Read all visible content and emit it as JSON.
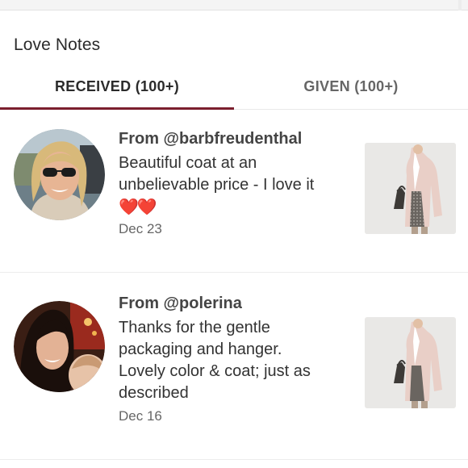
{
  "page": {
    "title": "Love Notes"
  },
  "tabs": [
    {
      "label": "RECEIVED (100+)",
      "active": true
    },
    {
      "label": "GIVEN (100+)",
      "active": false
    }
  ],
  "colors": {
    "accent": "#7b1f2e",
    "heart": "#e0202d"
  },
  "notes": [
    {
      "from": "From @barbfreudenthal",
      "message_lines": [
        "Beautiful coat at an",
        "unbelievable price - I love it"
      ],
      "emoji": "❤️❤️",
      "date": "Dec 23",
      "avatar_icon": "user-photo-woman-sunglasses",
      "product_icon": "pink-coat-product-photo"
    },
    {
      "from": "From @polerina",
      "message_lines": [
        "Thanks for the gentle",
        "packaging and hanger.",
        "Lovely color & coat; just as",
        "described"
      ],
      "date": "Dec 16",
      "avatar_icon": "user-photo-woman-brunette",
      "product_icon": "pink-coat-product-photo"
    }
  ]
}
